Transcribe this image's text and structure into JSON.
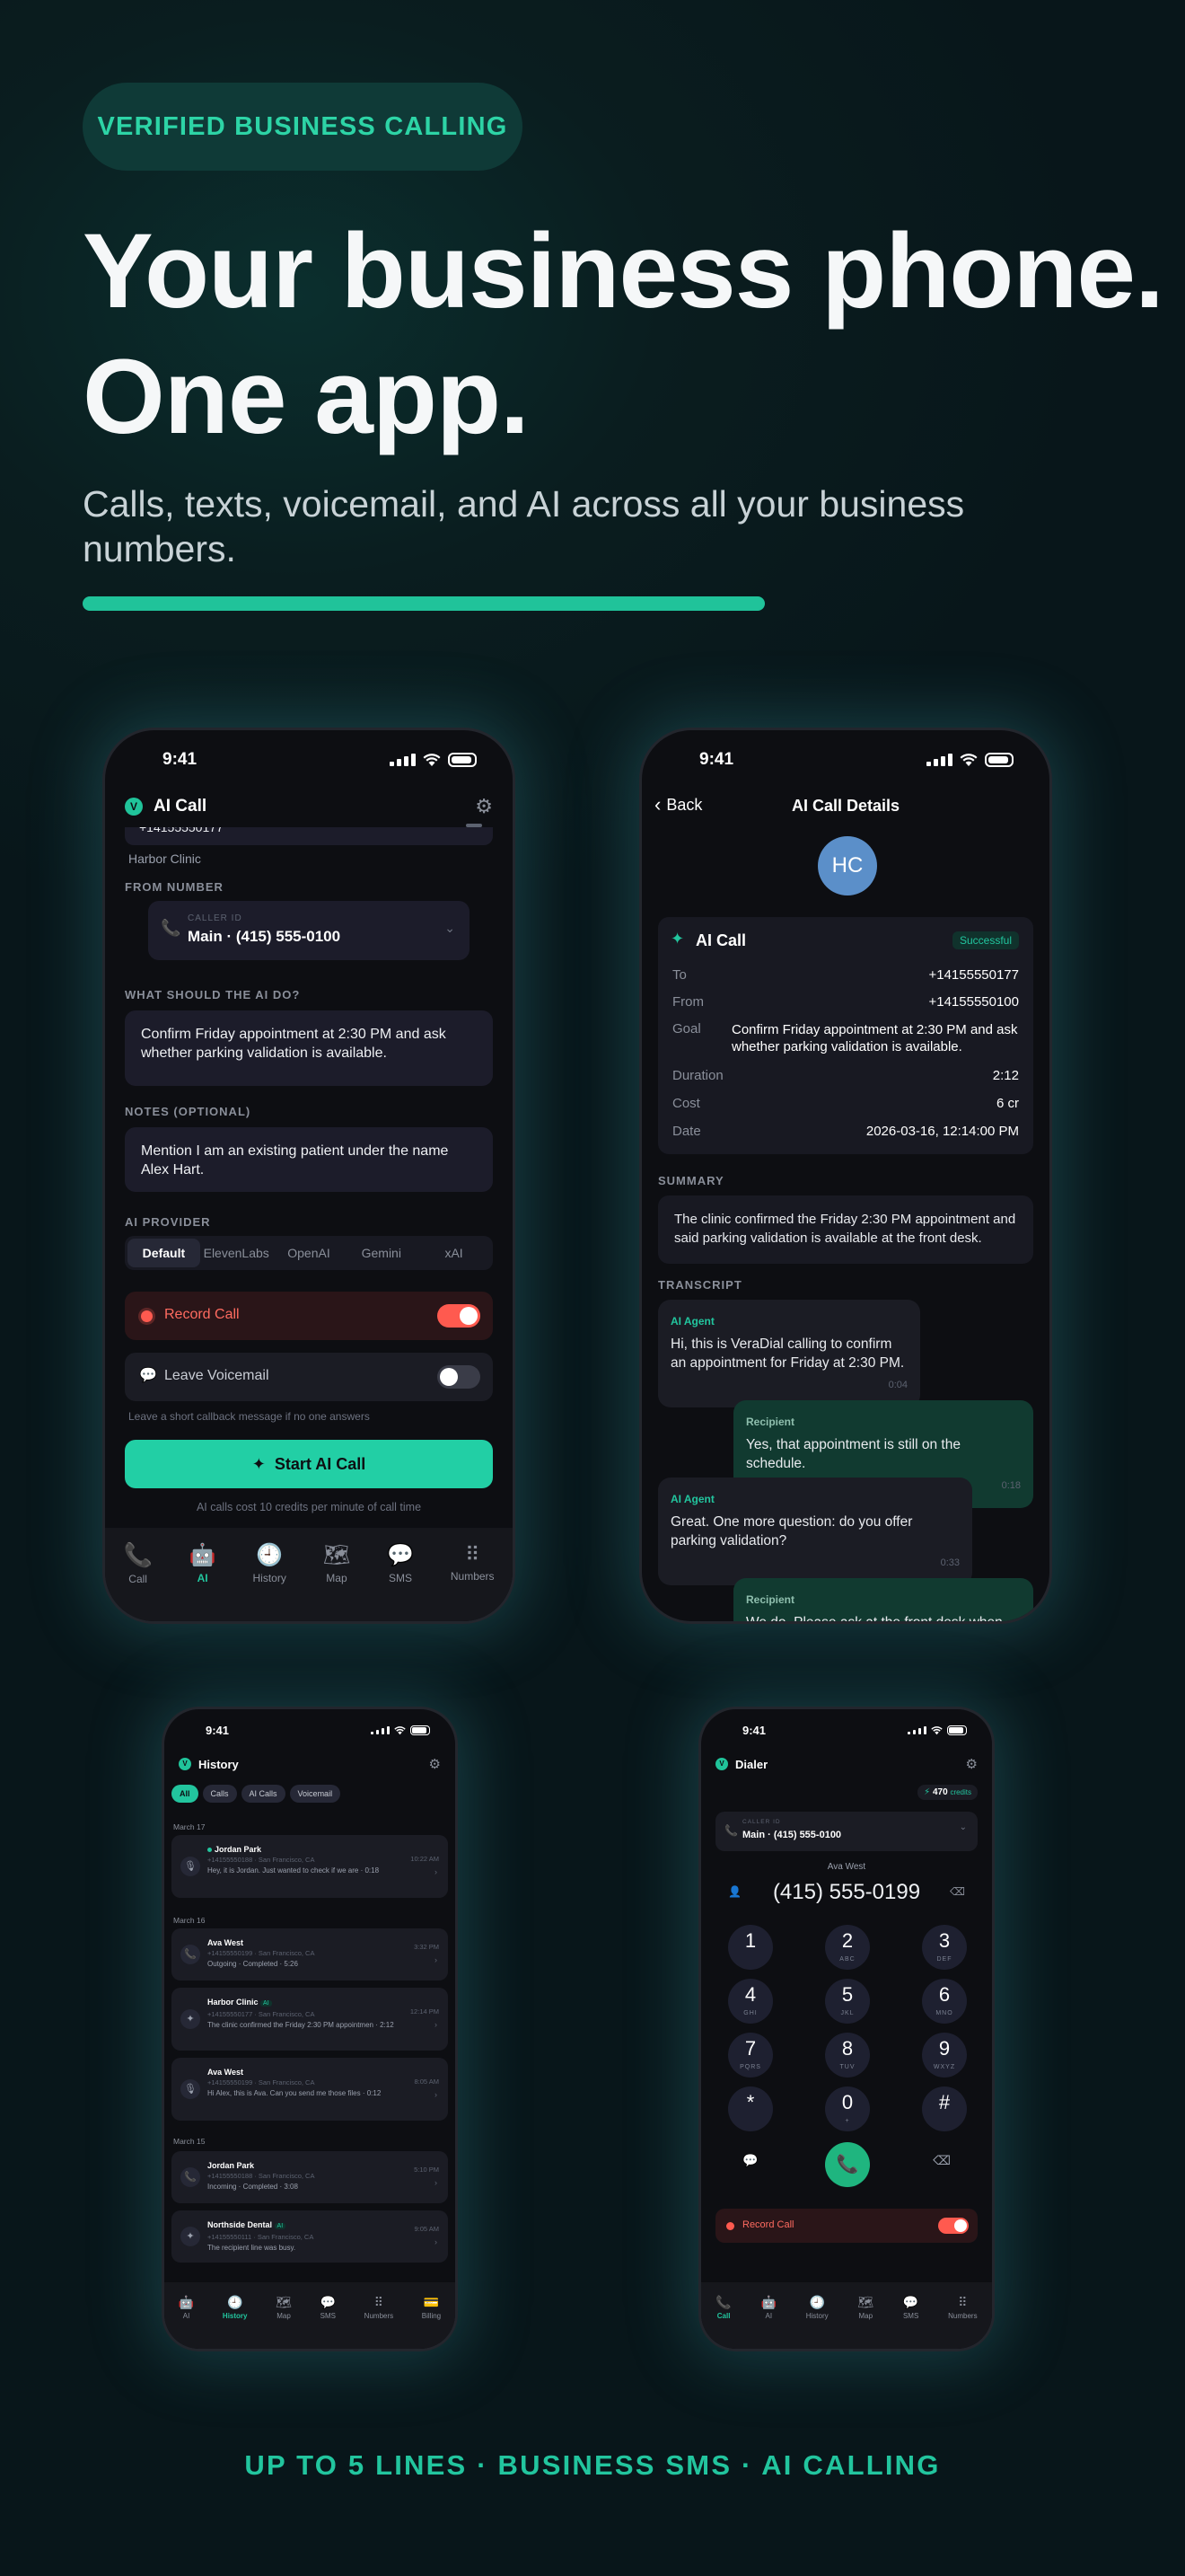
{
  "hero": {
    "badge": "VERIFIED BUSINESS CALLING",
    "headline_1": "Your business phone.",
    "headline_2": "One app.",
    "subheadline": "Calls, texts, voicemail, and AI across all your business numbers.",
    "footer": "UP TO 5 LINES · BUSINESS SMS · AI CALLING"
  },
  "colors": {
    "accent": "#20c39a",
    "record_red": "#ff5a4f",
    "bg": "#08161a",
    "avatar_blue": "#5b8fc9"
  },
  "status_time": "9:41",
  "ai_call": {
    "title": "AI Call",
    "partial_recipient": "+14155550177",
    "recipient_name": "Harbor Clinic",
    "from_label": "FROM NUMBER",
    "caller_id_label": "CALLER ID",
    "caller_id_value": "Main · (415) 555-0100",
    "task_label": "WHAT SHOULD THE AI DO?",
    "task_text": "Confirm Friday appointment at 2:30 PM and ask whether parking validation is available.",
    "notes_label": "NOTES (OPTIONAL)",
    "notes_text": "Mention I am an existing patient under the name Alex Hart.",
    "provider_label": "AI PROVIDER",
    "providers": [
      "Default",
      "ElevenLabs",
      "OpenAI",
      "Gemini",
      "xAI"
    ],
    "record_label": "Record Call",
    "record_on": true,
    "voicemail_label": "Leave Voicemail",
    "voicemail_on": false,
    "voicemail_hint": "Leave a short callback message if no one answers",
    "start_button": "Start AI Call",
    "cost_note": "AI calls cost 10 credits per minute of call time",
    "tabs": [
      "Call",
      "AI",
      "History",
      "Map",
      "SMS",
      "Numbers"
    ],
    "active_tab": "AI"
  },
  "details": {
    "back": "Back",
    "title": "AI Call Details",
    "avatar": "HC",
    "card_title": "AI Call",
    "status": "Successful",
    "rows": [
      {
        "k": "To",
        "v": "+14155550177"
      },
      {
        "k": "From",
        "v": "+14155550100"
      },
      {
        "k": "Goal",
        "v": "Confirm Friday appointment at 2:30 PM and ask whether parking validation is available."
      },
      {
        "k": "Duration",
        "v": "2:12"
      },
      {
        "k": "Cost",
        "v": "6 cr"
      },
      {
        "k": "Date",
        "v": "2026-03-16, 12:14:00 PM"
      }
    ],
    "summary_label": "SUMMARY",
    "summary": "The clinic confirmed the Friday 2:30 PM appointment and said parking validation is available at the front desk.",
    "transcript_label": "TRANSCRIPT",
    "transcript": [
      {
        "who": "AI Agent",
        "text": "Hi, this is VeraDial calling to confirm an appointment for Friday at 2:30 PM.",
        "t": "0:04"
      },
      {
        "who": "Recipient",
        "text": "Yes, that appointment is still on the schedule.",
        "t": "0:18"
      },
      {
        "who": "AI Agent",
        "text": "Great. One more question: do you offer parking validation?",
        "t": "0:33"
      },
      {
        "who": "Recipient",
        "text": "We do. Please ask at the front desk when you",
        "t": ""
      }
    ]
  },
  "history": {
    "title": "History",
    "filters": [
      "All",
      "Calls",
      "AI Calls",
      "Voicemail"
    ],
    "groups": [
      {
        "date": "March 17",
        "items": [
          {
            "name": "Jordan Park",
            "sub": "+14155550188 · San Francisco, CA",
            "desc": "Hey, it is Jordan. Just wanted to check if we are · 0:18",
            "time": "10:22 AM",
            "icon": "voicemail",
            "ai": false,
            "dot": true
          }
        ]
      },
      {
        "date": "March 16",
        "items": [
          {
            "name": "Ava West",
            "sub": "+14155550199 · San Francisco, CA",
            "desc": "Outgoing · Completed · 5:26",
            "time": "3:32 PM",
            "icon": "phone",
            "ai": false,
            "dot": false
          },
          {
            "name": "Harbor Clinic",
            "sub": "+14155550177 · San Francisco, CA",
            "desc": "The clinic confirmed the Friday 2:30 PM appointmen · 2:12",
            "time": "12:14 PM",
            "icon": "sparkle",
            "ai": true,
            "dot": false
          },
          {
            "name": "Ava West",
            "sub": "+14155550199 · San Francisco, CA",
            "desc": "Hi Alex, this is Ava. Can you send me those files · 0:12",
            "time": "8:05 AM",
            "icon": "voicemail",
            "ai": false,
            "dot": false
          }
        ]
      },
      {
        "date": "March 15",
        "items": [
          {
            "name": "Jordan Park",
            "sub": "+14155550188 · San Francisco, CA",
            "desc": "Incoming · Completed · 3:08",
            "time": "5:10 PM",
            "icon": "phone",
            "ai": false,
            "dot": false
          },
          {
            "name": "Northside Dental",
            "sub": "+14155550111 · San Francisco, CA",
            "desc": "The recipient line was busy.",
            "time": "9:05 AM",
            "icon": "sparkle",
            "ai": true,
            "dot": false
          }
        ]
      }
    ],
    "ai_badge": "AI",
    "tabs": [
      "AI",
      "History",
      "Map",
      "SMS",
      "Numbers",
      "Billing"
    ],
    "active_tab": "History"
  },
  "dialer": {
    "title": "Dialer",
    "credits": "470",
    "credits_label": "credits",
    "caller_id_label": "CALLER ID",
    "caller_id_value": "Main · (415) 555-0100",
    "contact": "Ava West",
    "number": "(415) 555-0199",
    "keys": [
      {
        "n": "1",
        "s": ""
      },
      {
        "n": "2",
        "s": "ABC"
      },
      {
        "n": "3",
        "s": "DEF"
      },
      {
        "n": "4",
        "s": "GHI"
      },
      {
        "n": "5",
        "s": "JKL"
      },
      {
        "n": "6",
        "s": "MNO"
      },
      {
        "n": "7",
        "s": "PQRS"
      },
      {
        "n": "8",
        "s": "TUV"
      },
      {
        "n": "9",
        "s": "WXYZ"
      },
      {
        "n": "*",
        "s": ""
      },
      {
        "n": "0",
        "s": "+"
      },
      {
        "n": "#",
        "s": ""
      }
    ],
    "record_label": "Record Call",
    "tabs": [
      "Call",
      "AI",
      "History",
      "Map",
      "SMS",
      "Numbers"
    ],
    "active_tab": "Call"
  }
}
